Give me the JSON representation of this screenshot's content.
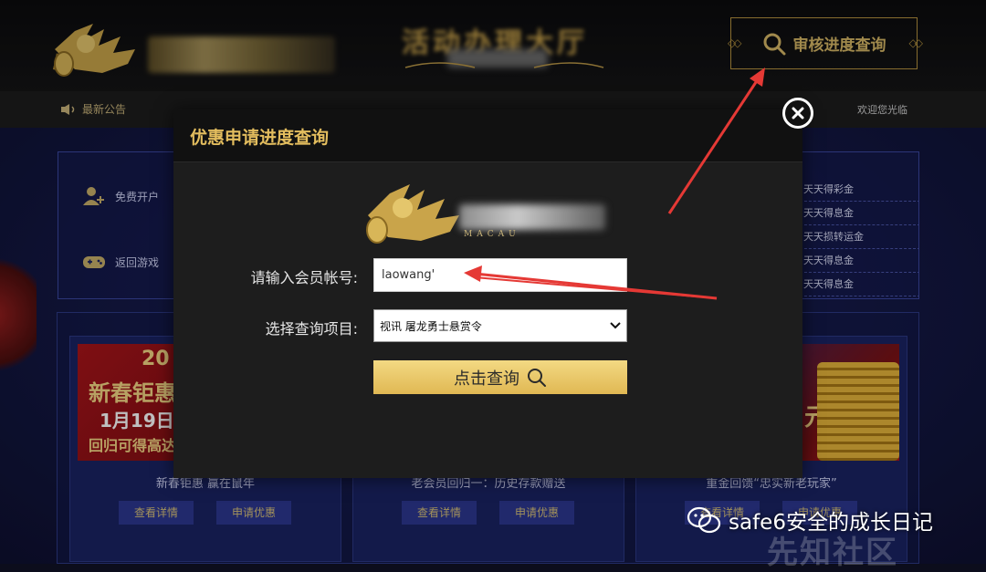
{
  "header": {
    "brand_text": "澳门威尼斯",
    "center_title": "活动办理大厅",
    "audit_button_label": "审核进度查询"
  },
  "nav": {
    "notice_label": "最新公告",
    "welcome_text": "欢迎您光临"
  },
  "left_panel": {
    "items": [
      {
        "label": "免费开户",
        "icon": "user-add-icon"
      },
      {
        "label": "返回游戏",
        "icon": "gamepad-icon"
      }
    ]
  },
  "right_panel": {
    "rows": [
      "天天得彩金",
      "天天得息金",
      "天天损转运金",
      "天天得息金",
      "天天得息金"
    ]
  },
  "promos": [
    {
      "caption": "新春钜惠 赢在鼠年",
      "detail_label": "查看详情",
      "apply_label": "申请优惠",
      "banner_title": "新春钜惠",
      "banner_date": "1月19日 -",
      "banner_sub": "回归可得高达",
      "banner_year": "20"
    },
    {
      "caption": "老会员回归一：历史存款赠送",
      "detail_label": "查看详情",
      "apply_label": "申请优惠"
    },
    {
      "caption": "重金回馈“忠实新老玩家”",
      "detail_label": "查看详情",
      "apply_label": "申请优惠",
      "banner_text": "元"
    }
  ],
  "modal": {
    "title": "优惠申请进度查询",
    "logo_caption": "MACAU",
    "account_label": "请输入会员帐号:",
    "account_value": "laowang'",
    "project_label": "选择查询项目:",
    "project_value": "视讯 屠龙勇士悬赏令",
    "query_button_label": "点击查询"
  },
  "watermark": {
    "channel": "safe6安全的成长日记",
    "site": "先知社区"
  },
  "colors": {
    "gold": "#e3bd5e",
    "arrow_red": "#e53935",
    "button_gold": "#e0b853"
  }
}
